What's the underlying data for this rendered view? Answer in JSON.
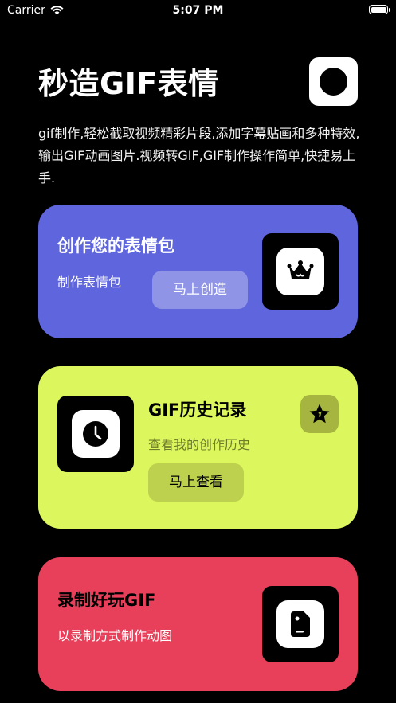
{
  "status_bar": {
    "carrier": "Carrier",
    "time": "5:07 PM"
  },
  "header": {
    "title": "秒造GIF表情",
    "description": "gif制作,轻松截取视频精彩片段,添加字幕贴画和多种特效,输出GIF动画图片.视频转GIF,GIF制作操作简单,快捷易上手."
  },
  "cards": {
    "create": {
      "title": "创作您的表情包",
      "subtitle": "制作表情包",
      "button": "马上创造",
      "color": "#5f66dd"
    },
    "history": {
      "title": "GIF历史记录",
      "subtitle": "查看我的创作历史",
      "button": "马上查看",
      "color": "#dcf75d"
    },
    "record": {
      "title": "录制好玩GIF",
      "subtitle": "以录制方式制作动图",
      "color": "#e8405a"
    }
  }
}
